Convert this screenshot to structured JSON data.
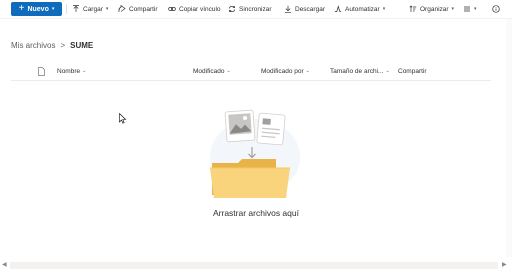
{
  "toolbar": {
    "new_label": "Nuevo",
    "items": [
      {
        "label": "Cargar",
        "icon": "upload-icon",
        "has_dropdown": true
      },
      {
        "label": "Compartir",
        "icon": "share-icon",
        "has_dropdown": false
      },
      {
        "label": "Copiar vínculo",
        "icon": "link-icon",
        "has_dropdown": false
      },
      {
        "label": "Sincronizar",
        "icon": "sync-icon",
        "has_dropdown": false
      },
      {
        "label": "Descargar",
        "icon": "download-icon",
        "has_dropdown": false
      },
      {
        "label": "Automatizar",
        "icon": "automate-icon",
        "has_dropdown": true
      }
    ],
    "right_items": [
      {
        "label": "Organizar",
        "icon": "sort-icon",
        "has_dropdown": true
      },
      {
        "label": "",
        "icon": "view-options-icon",
        "has_dropdown": true
      },
      {
        "label": "",
        "icon": "info-icon",
        "has_dropdown": false
      }
    ]
  },
  "breadcrumb": {
    "root": "Mis archivos",
    "separator": ">",
    "current": "SUME"
  },
  "columns": [
    {
      "label": "Nombre"
    },
    {
      "label": "Modificado"
    },
    {
      "label": "Modificado por"
    },
    {
      "label": "Tamaño de archi..."
    },
    {
      "label": "Compartir"
    }
  ],
  "empty_state": {
    "message": "Arrastrar archivos aquí"
  },
  "colors": {
    "accent": "#0f6cbd",
    "folder": "#f9d47d",
    "folder_front": "#f7c862"
  }
}
